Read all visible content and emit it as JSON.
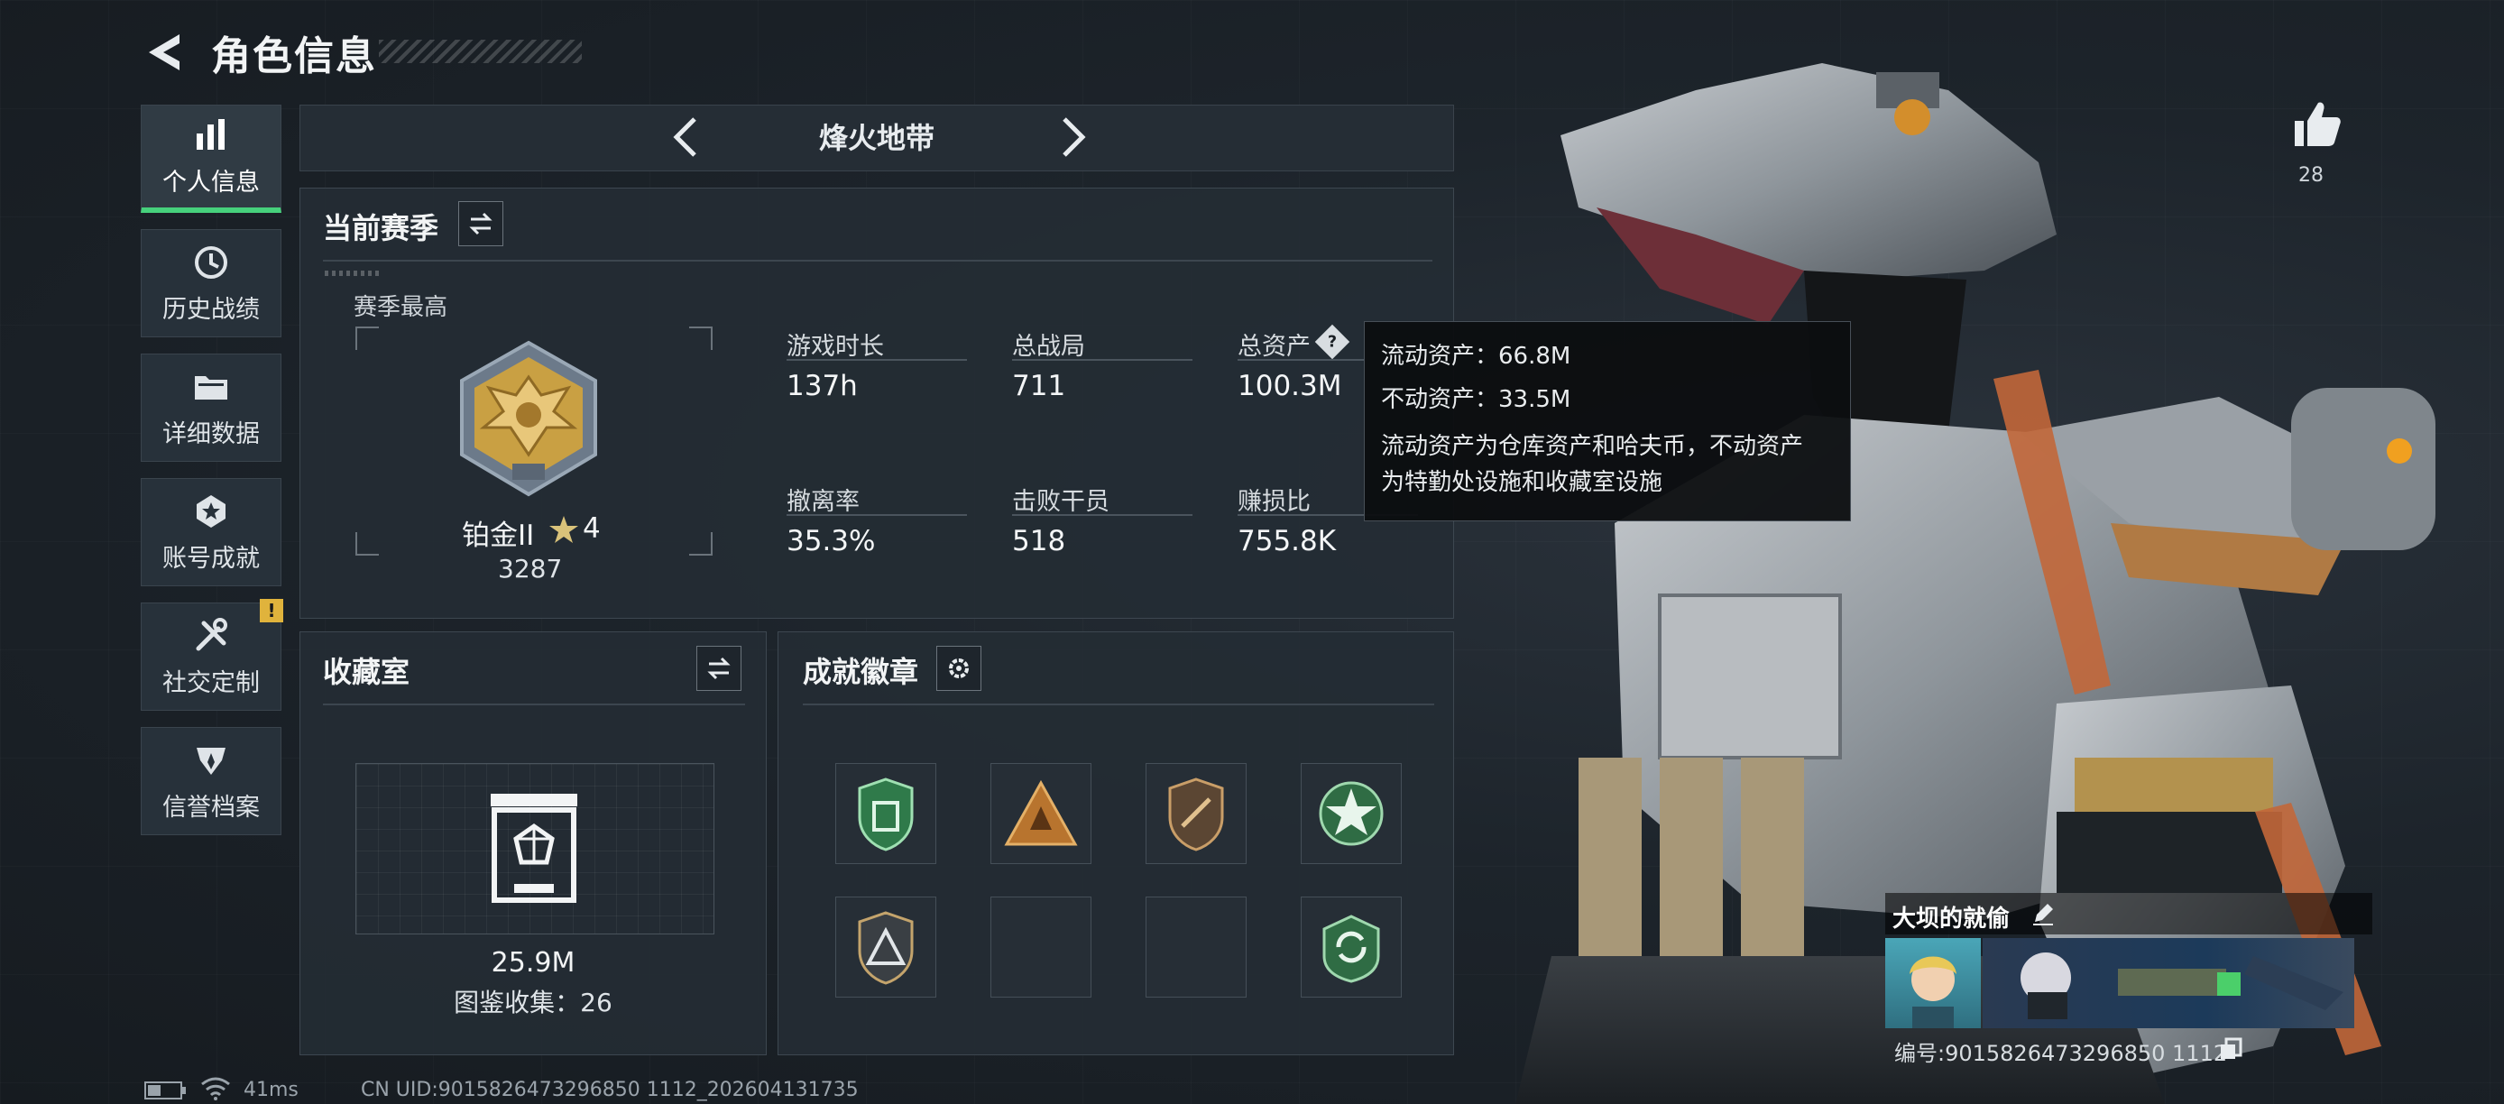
{
  "header": {
    "title": "角色信息"
  },
  "sidebar": {
    "items": [
      {
        "label": "个人信息",
        "icon": "bar-chart-icon",
        "active": true
      },
      {
        "label": "历史战绩",
        "icon": "history-clock-icon",
        "active": false
      },
      {
        "label": "详细数据",
        "icon": "folder-icon",
        "active": false
      },
      {
        "label": "账号成就",
        "icon": "achievement-icon",
        "active": false
      },
      {
        "label": "社交定制",
        "icon": "tools-icon",
        "active": false,
        "badge": "!"
      },
      {
        "label": "信誉档案",
        "icon": "reputation-icon",
        "active": false
      }
    ]
  },
  "mode": {
    "label": "烽火地带"
  },
  "season": {
    "title": "当前赛季",
    "best_label": "赛季最高",
    "rank_name": "铂金II",
    "rank_stars": "4",
    "rank_points": "3287",
    "stats": [
      {
        "label": "游戏时长",
        "value": "137h"
      },
      {
        "label": "总战局",
        "value": "711"
      },
      {
        "label": "总资产",
        "value": "100.3M"
      },
      {
        "label": "撤离率",
        "value": "35.3%"
      },
      {
        "label": "击败干员",
        "value": "518"
      },
      {
        "label": "赚损比",
        "value": "755.8K"
      }
    ]
  },
  "tooltip": {
    "liquid": "流动资产：66.8M",
    "fixed": "不动资产：33.5M",
    "note_line1": "流动资产为仓库资产和哈夫币，不动资产",
    "note_line2": "为特勤处设施和收藏室设施"
  },
  "collection": {
    "title": "收藏室",
    "value": "25.9M",
    "count_text": "图鉴收集：26"
  },
  "achievements": {
    "title": "成就徽章",
    "badges": [
      "green-shield-badge",
      "gold-triangle-badge",
      "bronze-shield-badge",
      "green-star-badge",
      "pyramid-badge",
      "empty-slot",
      "empty-slot",
      "green-cycle-badge"
    ]
  },
  "likes": {
    "count": "28"
  },
  "player": {
    "name": "大坝的就偷",
    "id_text": "编号:9015826473296850 1112"
  },
  "footer": {
    "ping": "41ms",
    "uid": "CN UID:9015826473296850 1112_202604131735"
  },
  "colors": {
    "accent_green": "#46d17c",
    "badge_yellow": "#e0b33c",
    "rank_gold": "#c9a043"
  }
}
